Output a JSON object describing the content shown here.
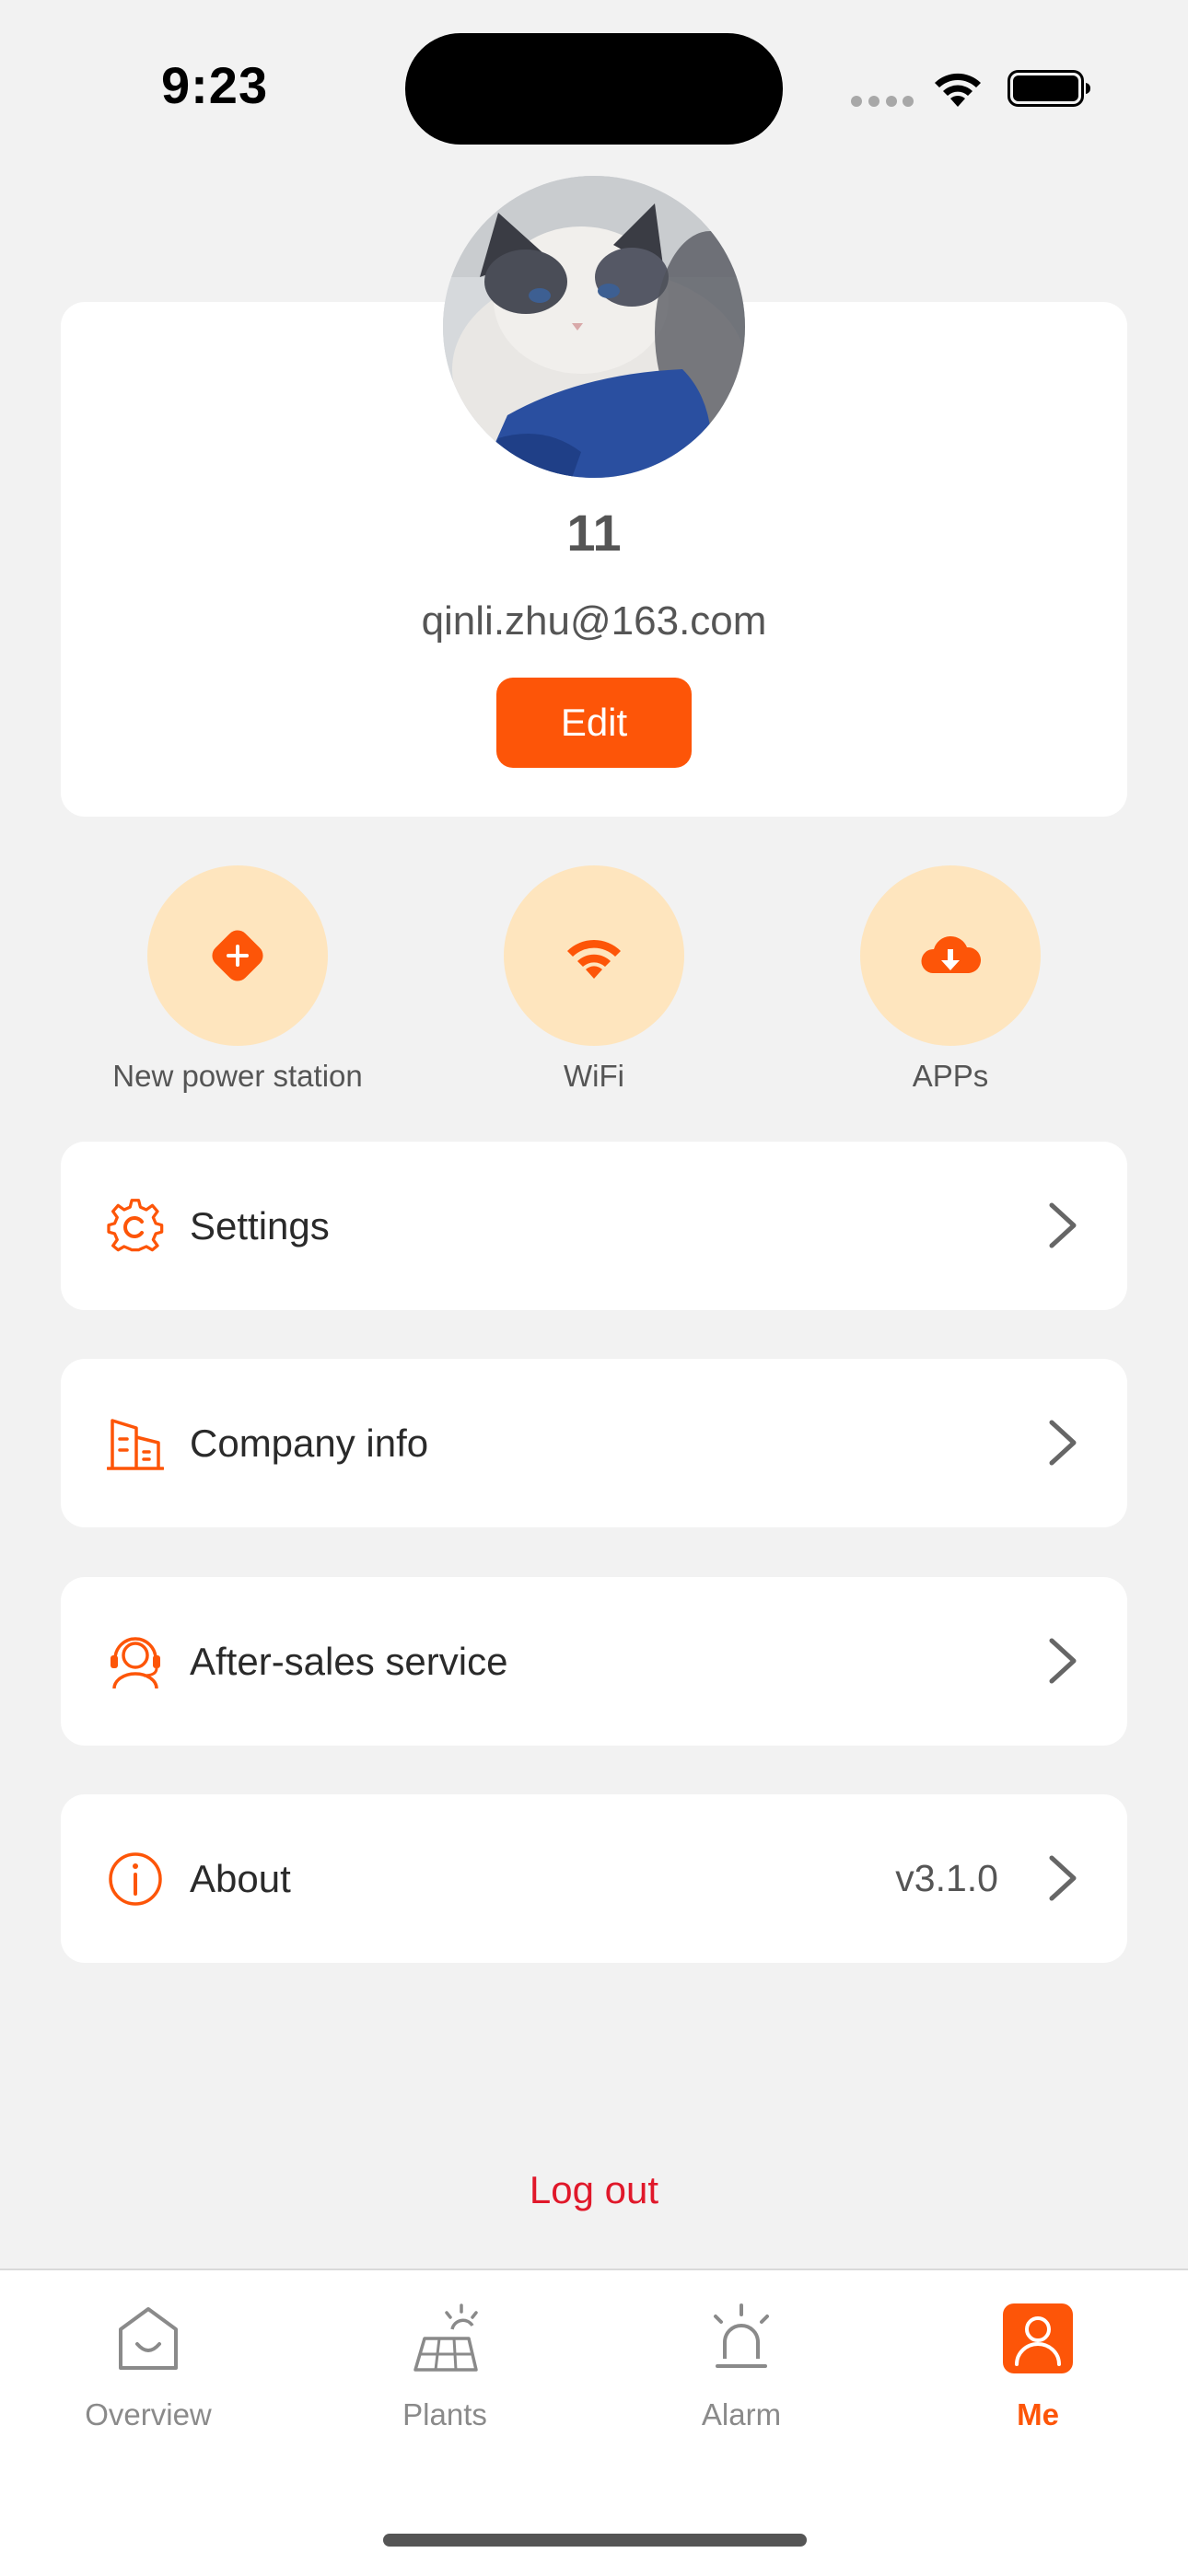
{
  "status_bar": {
    "time": "9:23",
    "icons": [
      "cellular-signal-icon",
      "wifi-icon",
      "battery-icon"
    ]
  },
  "profile": {
    "name": "11",
    "email": "qinli.zhu@163.com",
    "edit_label": "Edit",
    "avatar": "cat-photo"
  },
  "quick_actions": [
    {
      "label": "New power station",
      "icon": "add-station-icon"
    },
    {
      "label": "WiFi",
      "icon": "wifi-icon"
    },
    {
      "label": "APPs",
      "icon": "cloud-download-icon"
    }
  ],
  "menu": {
    "settings": {
      "label": "Settings",
      "icon": "settings-gear-icon"
    },
    "company_info": {
      "label": "Company info",
      "icon": "building-icon"
    },
    "after_sales": {
      "label": "After-sales service",
      "icon": "headset-icon"
    },
    "about": {
      "label": "About",
      "icon": "info-icon",
      "value": "v3.1.0"
    }
  },
  "logout_label": "Log out",
  "tabs": [
    {
      "label": "Overview",
      "icon": "home-icon",
      "active": false
    },
    {
      "label": "Plants",
      "icon": "solar-panel-icon",
      "active": false
    },
    {
      "label": "Alarm",
      "icon": "alarm-light-icon",
      "active": false
    },
    {
      "label": "Me",
      "icon": "person-icon",
      "active": true
    }
  ],
  "colors": {
    "accent": "#fd5508",
    "accent_light": "#fee5be",
    "logout": "#e0182a",
    "background": "#f2f2f2"
  }
}
